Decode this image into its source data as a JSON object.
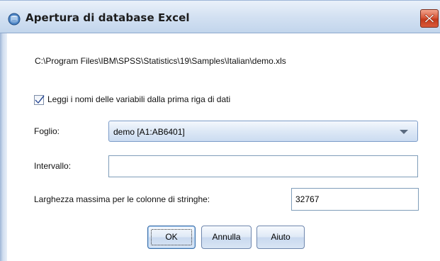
{
  "window": {
    "title": "Apertura di database Excel",
    "icon": "database-icon",
    "close_icon": "close-icon"
  },
  "file_path": "C:\\Program Files\\IBM\\SPSS\\Statistics\\19\\Samples\\Italian\\demo.xls",
  "read_names": {
    "label": "Leggi i nomi delle variabili dalla prima riga di dati",
    "checked": true
  },
  "sheet": {
    "label": "Foglio:",
    "selected": "demo [A1:AB6401]"
  },
  "range": {
    "label": "Intervallo:",
    "value": ""
  },
  "max_width": {
    "label": "Larghezza massima per le colonne di stringhe:",
    "value": "32767"
  },
  "buttons": {
    "ok": "OK",
    "cancel": "Annulla",
    "help": "Aiuto"
  },
  "colors": {
    "title_gradient_top": "#eaf1fa",
    "title_gradient_bottom": "#c2d5ec",
    "close_button": "#c8432a",
    "check_mark": "#1d3f8f"
  }
}
